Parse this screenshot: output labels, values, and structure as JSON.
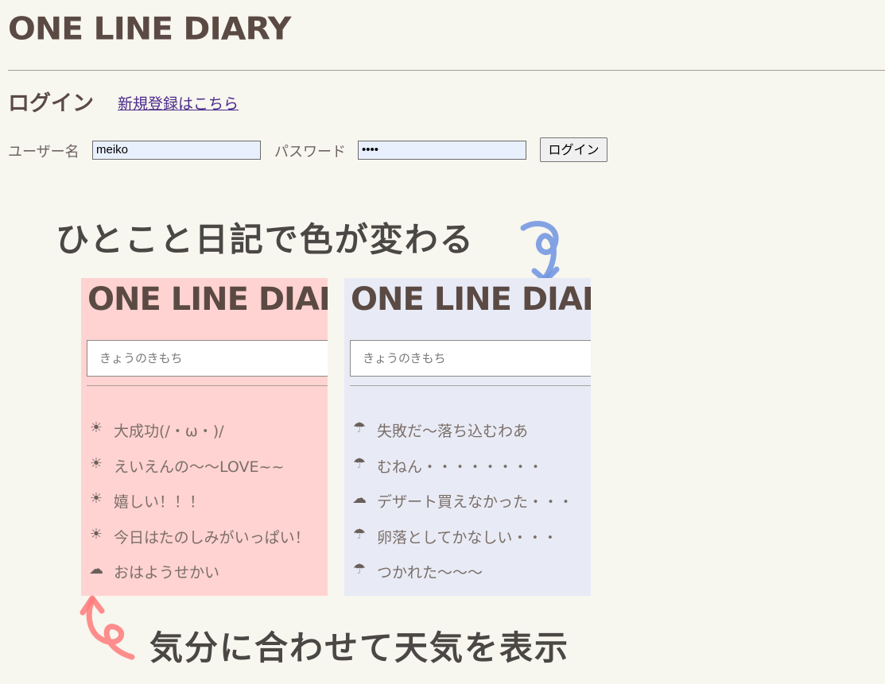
{
  "header": {
    "logo": "ONE LINE DIARY"
  },
  "login": {
    "heading": "ログイン",
    "signup_link": "新規登録はこちら",
    "username_label": "ユーザー名",
    "username_value": "meiko",
    "password_label": "パスワード",
    "password_value": "••••",
    "submit_label": "ログイン"
  },
  "promo": {
    "title": "ひとこと日記で色が変わる",
    "footer": "気分に合わせて天気を表示",
    "panels": [
      {
        "logo": "ONE LINE DIARY",
        "placeholder": "きょうのきもち",
        "bg": "#ffd3d1",
        "items": [
          {
            "icon": "sun-icon",
            "text": "大成功(/・ω・)/"
          },
          {
            "icon": "sun-icon",
            "text": "えいえんの〜〜LOVE~~"
          },
          {
            "icon": "sun-icon",
            "text": "嬉しい！！！"
          },
          {
            "icon": "sun-icon",
            "text": "今日はたのしみがいっぱい！"
          },
          {
            "icon": "cloud-icon",
            "text": "おはようせかい"
          }
        ]
      },
      {
        "logo": "ONE LINE DIARY",
        "placeholder": "きょうのきもち",
        "bg": "#e8ebf5",
        "items": [
          {
            "icon": "umbrella-icon",
            "text": "失敗だ〜落ち込むわあ"
          },
          {
            "icon": "umbrella-icon",
            "text": "むねん・・・・・・・・"
          },
          {
            "icon": "cloud-icon",
            "text": "デザート買えなかった・・・"
          },
          {
            "icon": "umbrella-icon",
            "text": "卵落としてかなしい・・・"
          },
          {
            "icon": "umbrella-icon",
            "text": "つかれた〜〜〜"
          }
        ]
      }
    ]
  },
  "colors": {
    "background": "#f7f6ef",
    "text": "#5b4a44",
    "link": "#4b2a8a",
    "arrow_blue": "#6f93e0",
    "arrow_red": "#ff7a7a"
  }
}
